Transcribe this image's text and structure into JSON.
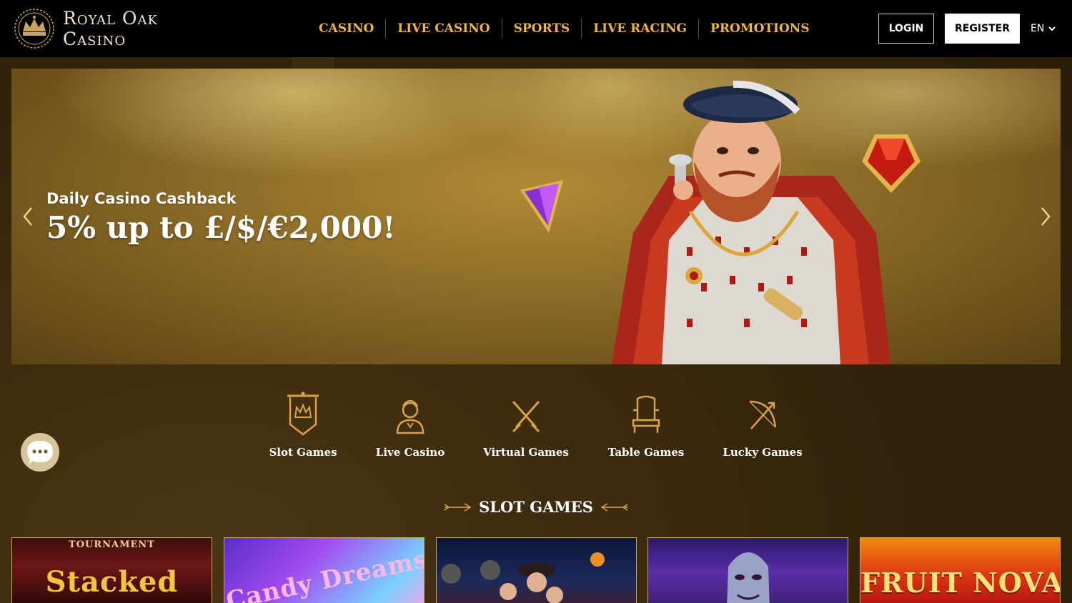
{
  "header": {
    "logo_line1": "Royal Oak",
    "logo_line2": "Casino",
    "nav": [
      "CASINO",
      "LIVE CASINO",
      "SPORTS",
      "LIVE RACING",
      "PROMOTIONS"
    ],
    "login_label": "LOGIN",
    "register_label": "REGISTER",
    "language": "EN"
  },
  "banner": {
    "subtitle": "Daily Casino Cashback",
    "title": "5% up to £/$/€2,000!"
  },
  "categories": [
    {
      "label": "Slot Games",
      "icon": "banner-crown-icon"
    },
    {
      "label": "Live Casino",
      "icon": "dealer-icon"
    },
    {
      "label": "Virtual Games",
      "icon": "crossed-swords-icon"
    },
    {
      "label": "Table Games",
      "icon": "throne-icon"
    },
    {
      "label": "Lucky Games",
      "icon": "bow-arrow-icon"
    }
  ],
  "section": {
    "title": "SLOT GAMES"
  },
  "games": [
    {
      "label": "Stacked",
      "tag": "TOURNAMENT"
    },
    {
      "label": "Candy Dreams",
      "tag": ""
    },
    {
      "label": "",
      "tag": ""
    },
    {
      "label": "",
      "tag": ""
    },
    {
      "label": "FRUIT NOVA",
      "tag": ""
    }
  ],
  "colors": {
    "accent_gold": "#f0b53a",
    "header_bg": "#000000",
    "page_bg": "#33240b"
  }
}
